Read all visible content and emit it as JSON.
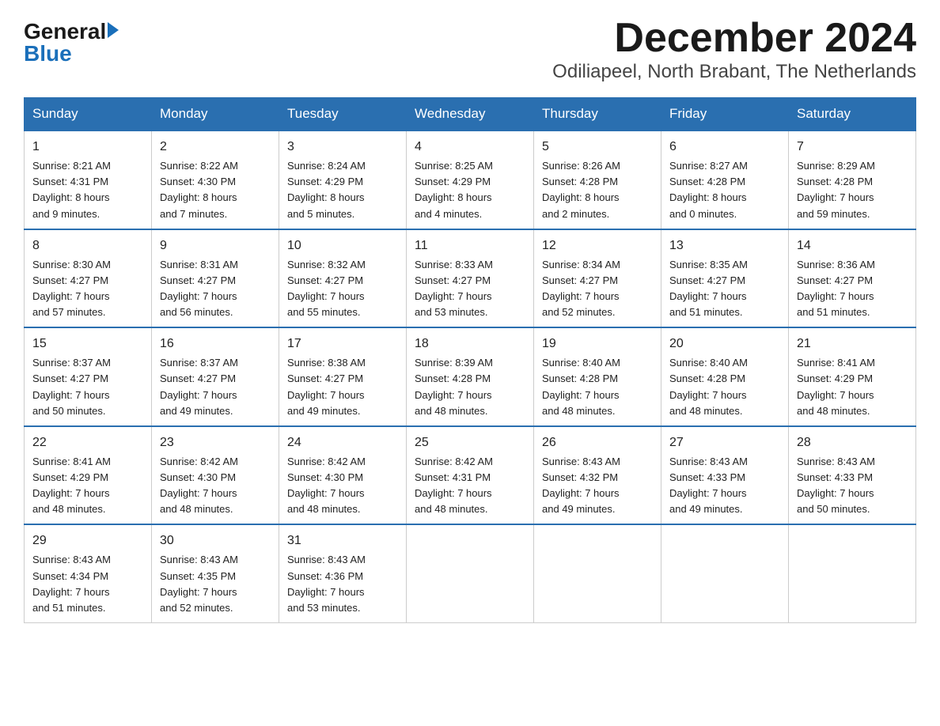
{
  "logo": {
    "general": "General",
    "blue": "Blue"
  },
  "title": "December 2024",
  "subtitle": "Odiliapeel, North Brabant, The Netherlands",
  "days_of_week": [
    "Sunday",
    "Monday",
    "Tuesday",
    "Wednesday",
    "Thursday",
    "Friday",
    "Saturday"
  ],
  "weeks": [
    [
      {
        "day": "1",
        "info": "Sunrise: 8:21 AM\nSunset: 4:31 PM\nDaylight: 8 hours\nand 9 minutes."
      },
      {
        "day": "2",
        "info": "Sunrise: 8:22 AM\nSunset: 4:30 PM\nDaylight: 8 hours\nand 7 minutes."
      },
      {
        "day": "3",
        "info": "Sunrise: 8:24 AM\nSunset: 4:29 PM\nDaylight: 8 hours\nand 5 minutes."
      },
      {
        "day": "4",
        "info": "Sunrise: 8:25 AM\nSunset: 4:29 PM\nDaylight: 8 hours\nand 4 minutes."
      },
      {
        "day": "5",
        "info": "Sunrise: 8:26 AM\nSunset: 4:28 PM\nDaylight: 8 hours\nand 2 minutes."
      },
      {
        "day": "6",
        "info": "Sunrise: 8:27 AM\nSunset: 4:28 PM\nDaylight: 8 hours\nand 0 minutes."
      },
      {
        "day": "7",
        "info": "Sunrise: 8:29 AM\nSunset: 4:28 PM\nDaylight: 7 hours\nand 59 minutes."
      }
    ],
    [
      {
        "day": "8",
        "info": "Sunrise: 8:30 AM\nSunset: 4:27 PM\nDaylight: 7 hours\nand 57 minutes."
      },
      {
        "day": "9",
        "info": "Sunrise: 8:31 AM\nSunset: 4:27 PM\nDaylight: 7 hours\nand 56 minutes."
      },
      {
        "day": "10",
        "info": "Sunrise: 8:32 AM\nSunset: 4:27 PM\nDaylight: 7 hours\nand 55 minutes."
      },
      {
        "day": "11",
        "info": "Sunrise: 8:33 AM\nSunset: 4:27 PM\nDaylight: 7 hours\nand 53 minutes."
      },
      {
        "day": "12",
        "info": "Sunrise: 8:34 AM\nSunset: 4:27 PM\nDaylight: 7 hours\nand 52 minutes."
      },
      {
        "day": "13",
        "info": "Sunrise: 8:35 AM\nSunset: 4:27 PM\nDaylight: 7 hours\nand 51 minutes."
      },
      {
        "day": "14",
        "info": "Sunrise: 8:36 AM\nSunset: 4:27 PM\nDaylight: 7 hours\nand 51 minutes."
      }
    ],
    [
      {
        "day": "15",
        "info": "Sunrise: 8:37 AM\nSunset: 4:27 PM\nDaylight: 7 hours\nand 50 minutes."
      },
      {
        "day": "16",
        "info": "Sunrise: 8:37 AM\nSunset: 4:27 PM\nDaylight: 7 hours\nand 49 minutes."
      },
      {
        "day": "17",
        "info": "Sunrise: 8:38 AM\nSunset: 4:27 PM\nDaylight: 7 hours\nand 49 minutes."
      },
      {
        "day": "18",
        "info": "Sunrise: 8:39 AM\nSunset: 4:28 PM\nDaylight: 7 hours\nand 48 minutes."
      },
      {
        "day": "19",
        "info": "Sunrise: 8:40 AM\nSunset: 4:28 PM\nDaylight: 7 hours\nand 48 minutes."
      },
      {
        "day": "20",
        "info": "Sunrise: 8:40 AM\nSunset: 4:28 PM\nDaylight: 7 hours\nand 48 minutes."
      },
      {
        "day": "21",
        "info": "Sunrise: 8:41 AM\nSunset: 4:29 PM\nDaylight: 7 hours\nand 48 minutes."
      }
    ],
    [
      {
        "day": "22",
        "info": "Sunrise: 8:41 AM\nSunset: 4:29 PM\nDaylight: 7 hours\nand 48 minutes."
      },
      {
        "day": "23",
        "info": "Sunrise: 8:42 AM\nSunset: 4:30 PM\nDaylight: 7 hours\nand 48 minutes."
      },
      {
        "day": "24",
        "info": "Sunrise: 8:42 AM\nSunset: 4:30 PM\nDaylight: 7 hours\nand 48 minutes."
      },
      {
        "day": "25",
        "info": "Sunrise: 8:42 AM\nSunset: 4:31 PM\nDaylight: 7 hours\nand 48 minutes."
      },
      {
        "day": "26",
        "info": "Sunrise: 8:43 AM\nSunset: 4:32 PM\nDaylight: 7 hours\nand 49 minutes."
      },
      {
        "day": "27",
        "info": "Sunrise: 8:43 AM\nSunset: 4:33 PM\nDaylight: 7 hours\nand 49 minutes."
      },
      {
        "day": "28",
        "info": "Sunrise: 8:43 AM\nSunset: 4:33 PM\nDaylight: 7 hours\nand 50 minutes."
      }
    ],
    [
      {
        "day": "29",
        "info": "Sunrise: 8:43 AM\nSunset: 4:34 PM\nDaylight: 7 hours\nand 51 minutes."
      },
      {
        "day": "30",
        "info": "Sunrise: 8:43 AM\nSunset: 4:35 PM\nDaylight: 7 hours\nand 52 minutes."
      },
      {
        "day": "31",
        "info": "Sunrise: 8:43 AM\nSunset: 4:36 PM\nDaylight: 7 hours\nand 53 minutes."
      },
      null,
      null,
      null,
      null
    ]
  ]
}
